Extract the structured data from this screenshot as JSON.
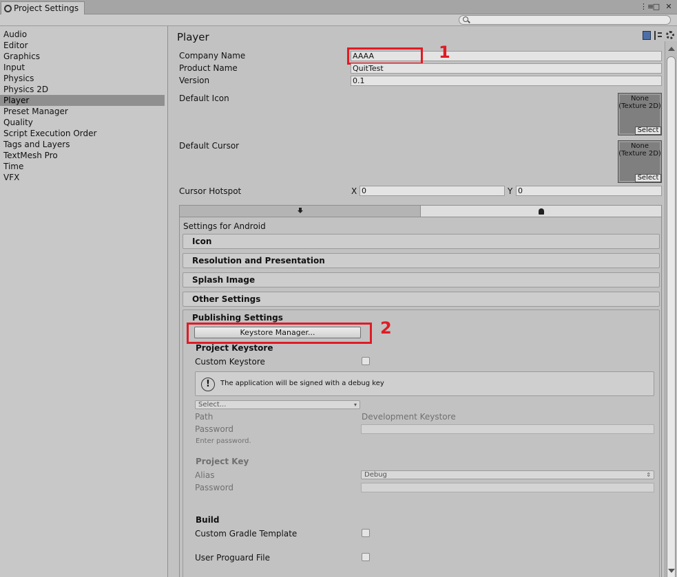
{
  "window": {
    "tab_title": "Project Settings",
    "controls": [
      "⋮≡",
      "□",
      "✕"
    ]
  },
  "sidebar": {
    "items": [
      {
        "label": "Audio"
      },
      {
        "label": "Editor"
      },
      {
        "label": "Graphics"
      },
      {
        "label": "Input"
      },
      {
        "label": "Physics"
      },
      {
        "label": "Physics 2D"
      },
      {
        "label": "Player",
        "active": true
      },
      {
        "label": "Preset Manager"
      },
      {
        "label": "Quality"
      },
      {
        "label": "Script Execution Order"
      },
      {
        "label": "Tags and Layers"
      },
      {
        "label": "TextMesh Pro"
      },
      {
        "label": "Time"
      },
      {
        "label": "VFX"
      }
    ]
  },
  "player": {
    "title": "Player",
    "company_label": "Company Name",
    "company_value": "AAAA",
    "product_label": "Product Name",
    "product_value": "QuitTest",
    "version_label": "Version",
    "version_value": "0.1",
    "default_icon_label": "Default Icon",
    "default_cursor_label": "Default Cursor",
    "texture_none": "None (Texture 2D)",
    "select_label": "Select",
    "hotspot_label": "Cursor Hotspot",
    "hotspot_x_label": "X",
    "hotspot_x": "0",
    "hotspot_y_label": "Y",
    "hotspot_y": "0"
  },
  "android": {
    "settings_for": "Settings for Android",
    "sections": [
      "Icon",
      "Resolution and Presentation",
      "Splash Image",
      "Other Settings"
    ],
    "publishing": {
      "title": "Publishing Settings",
      "keystore_manager_button": "Keystore Manager...",
      "project_keystore": "Project Keystore",
      "custom_keystore_label": "Custom Keystore",
      "info_text": "The application will be signed with a debug key",
      "select_dropdown": "Select...",
      "path_label": "Path",
      "path_value": "Development Keystore",
      "password_label": "Password",
      "enter_password": "Enter password.",
      "project_key": "Project Key",
      "alias_label": "Alias",
      "alias_value": "Debug",
      "key_password_label": "Password",
      "build": "Build",
      "custom_gradle_label": "Custom Gradle Template",
      "user_proguard_label": "User Proguard File"
    }
  },
  "annotations": {
    "one": "1",
    "two": "2"
  },
  "colors": {
    "highlight": "#e01b24",
    "active_item": "#8f8f8f"
  }
}
